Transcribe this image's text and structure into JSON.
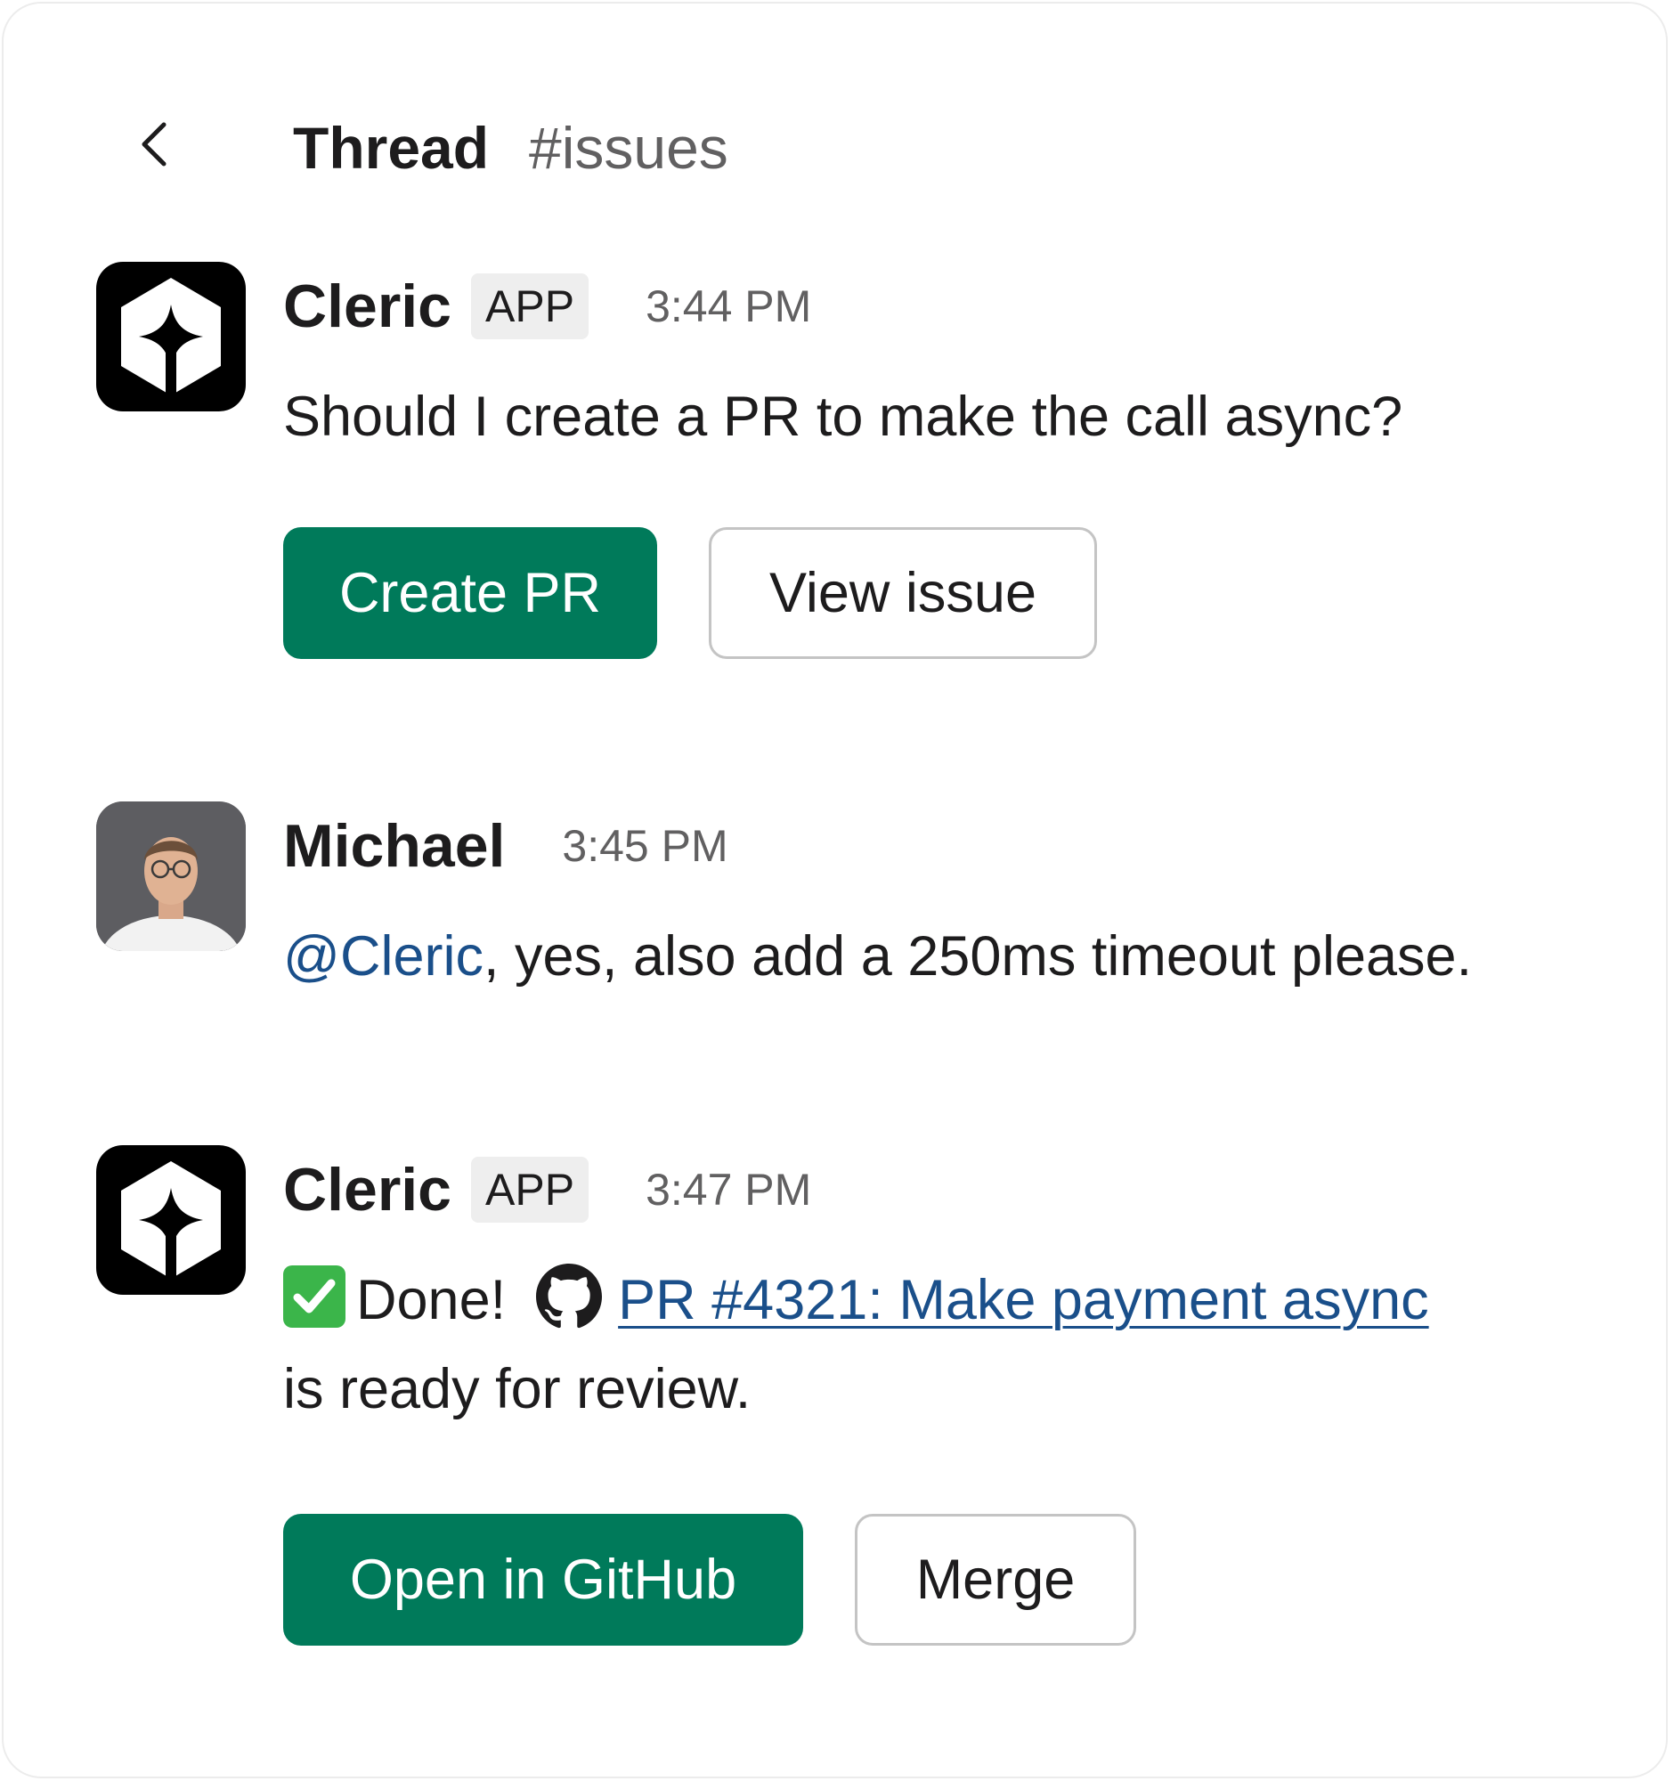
{
  "header": {
    "title": "Thread",
    "channel": "#issues"
  },
  "messages": [
    {
      "sender": "Cleric",
      "badge": "APP",
      "time": "3:44 PM",
      "text": "Should I create a PR to make the call async?",
      "buttons": {
        "primary": "Create PR",
        "secondary": "View issue"
      }
    },
    {
      "sender": "Michael",
      "time": "3:45 PM",
      "mention": "@Cleric",
      "text": ", yes, also add a 250ms timeout please."
    },
    {
      "sender": "Cleric",
      "badge": "APP",
      "time": "3:47 PM",
      "done_text": "Done!",
      "link_text": "PR #4321: Make payment async",
      "text_line2": "is ready for review.",
      "buttons": {
        "primary": "Open in GitHub",
        "secondary": "Merge"
      }
    }
  ],
  "icons": {
    "back": "chevron-left-icon",
    "check": "white-check-mark-icon",
    "github": "github-icon"
  },
  "colors": {
    "primary_button": "#007a5a",
    "link": "#1a4f8a",
    "timestamp": "#616061",
    "check": "#3bb54a"
  }
}
